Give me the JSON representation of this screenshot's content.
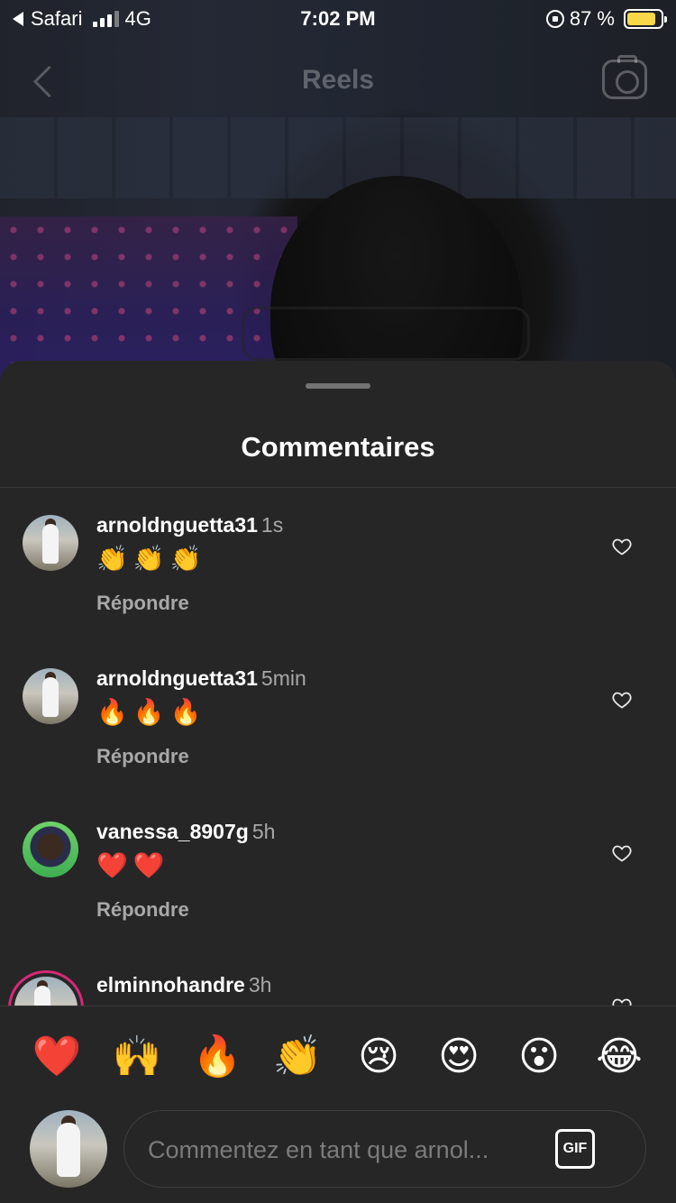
{
  "status_bar": {
    "back_app": "Safari",
    "network": "4G",
    "time": "7:02 PM",
    "battery": "87 %",
    "battery_level": 0.87
  },
  "header": {
    "title": "Reels"
  },
  "sheet": {
    "title": "Commentaires"
  },
  "comments": [
    {
      "username": "arnoldnguetta31",
      "time": "1s",
      "text": "👏👏👏",
      "reply": "Répondre",
      "avatar": "white-shirt-avatar"
    },
    {
      "username": "arnoldnguetta31",
      "time": "5min",
      "text": "🔥🔥🔥",
      "reply": "Répondre",
      "avatar": "white-shirt-avatar"
    },
    {
      "username": "vanessa_8907g",
      "time": "5h",
      "text": "❤️❤️",
      "reply": "Répondre",
      "avatar": "green-bg-avatar"
    },
    {
      "username": "elminnohandre",
      "time": "3h",
      "text": "",
      "reply": "",
      "avatar": "story-ring-avatar"
    }
  ],
  "quick_reactions": [
    "❤️",
    "🙌",
    "🔥",
    "👏",
    "😢",
    "😍",
    "😮",
    "😂"
  ],
  "composer": {
    "placeholder": "Commentez en tant que arnol...",
    "gif_label": "GIF"
  },
  "colors": {
    "sheet_bg": "#262626",
    "text_secondary": "#a8a8a8",
    "battery": "#f8d748"
  }
}
